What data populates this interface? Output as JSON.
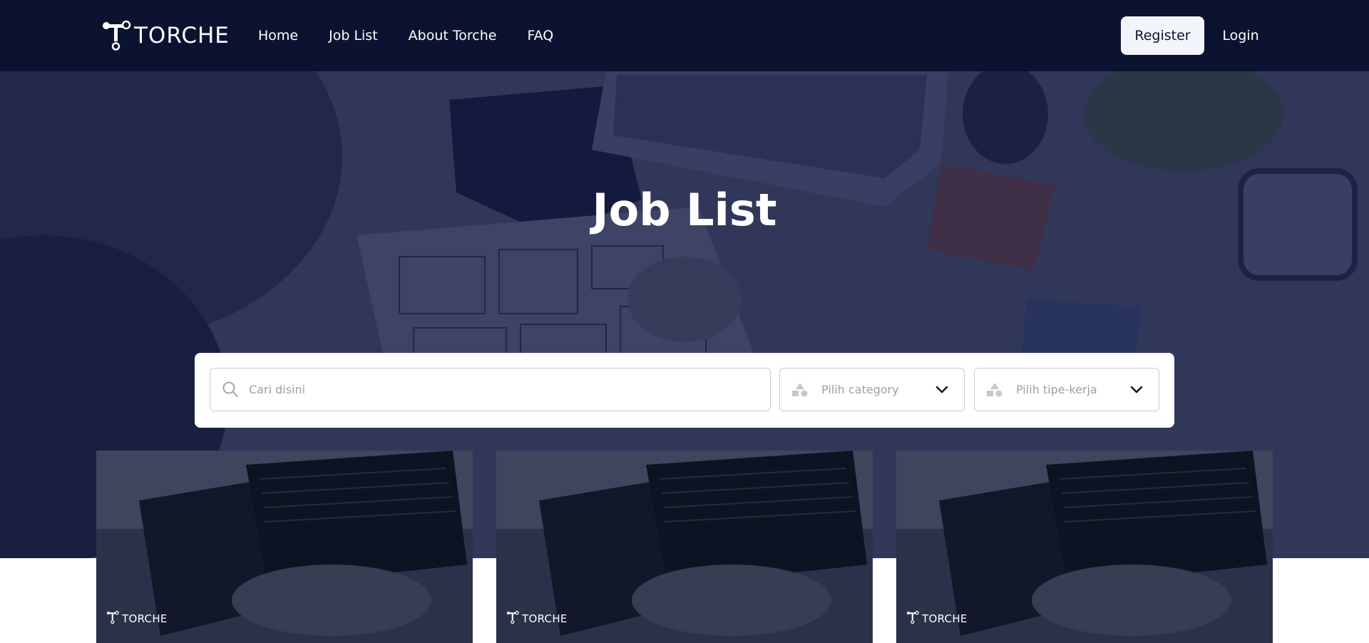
{
  "brand": {
    "name": "TORCHE"
  },
  "nav": {
    "items": [
      {
        "label": "Home"
      },
      {
        "label": "Job List"
      },
      {
        "label": "About Torche"
      },
      {
        "label": "FAQ"
      }
    ],
    "register_label": "Register",
    "login_label": "Login"
  },
  "hero": {
    "title": "Job List"
  },
  "search": {
    "placeholder": "Cari disini",
    "value": "",
    "category_placeholder": "Pilih category",
    "work_type_placeholder": "Pilih tipe-kerja"
  },
  "cards": [
    {
      "brand": "TORCHE"
    },
    {
      "brand": "TORCHE"
    },
    {
      "brand": "TORCHE"
    }
  ],
  "colors": {
    "navbar_bg": "#0b1330",
    "register_bg": "#f3f5fb",
    "hero_overlay": "#0e163c"
  },
  "icons": {
    "logo": "torche-logo-icon",
    "search": "search-icon",
    "category": "shapes-icon",
    "work_type": "shapes-icon",
    "dropdown": "chevron-down-icon"
  }
}
